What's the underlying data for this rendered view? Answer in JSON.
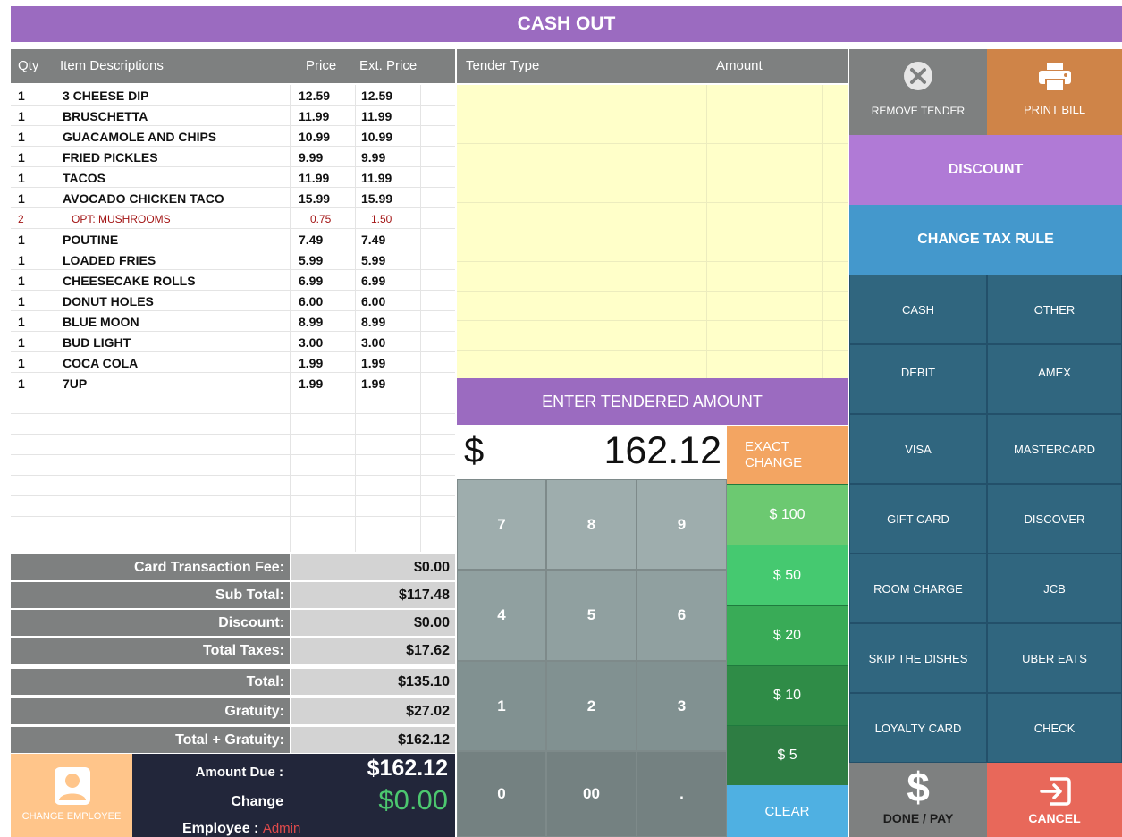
{
  "title": "CASH OUT",
  "items_table": {
    "headers": {
      "qty": "Qty",
      "desc": "Item Descriptions",
      "price": "Price",
      "ext": "Ext. Price"
    },
    "rows": [
      {
        "qty": "1",
        "desc": "3 CHEESE DIP",
        "price": "12.59",
        "ext": "12.59"
      },
      {
        "qty": "1",
        "desc": "BRUSCHETTA",
        "price": "11.99",
        "ext": "11.99"
      },
      {
        "qty": "1",
        "desc": "GUACAMOLE AND CHIPS",
        "price": "10.99",
        "ext": "10.99"
      },
      {
        "qty": "1",
        "desc": "FRIED PICKLES",
        "price": "9.99",
        "ext": "9.99"
      },
      {
        "qty": "1",
        "desc": "TACOS",
        "price": "11.99",
        "ext": "11.99"
      },
      {
        "qty": "1",
        "desc": "AVOCADO CHICKEN TACO",
        "price": "15.99",
        "ext": "15.99"
      },
      {
        "qty": "2",
        "desc": "OPT: MUSHROOMS",
        "price": "0.75",
        "ext": "1.50"
      },
      {
        "qty": "1",
        "desc": "POUTINE",
        "price": "7.49",
        "ext": "7.49"
      },
      {
        "qty": "1",
        "desc": "LOADED FRIES",
        "price": "5.99",
        "ext": "5.99"
      },
      {
        "qty": "1",
        "desc": "CHEESECAKE ROLLS",
        "price": "6.99",
        "ext": "6.99"
      },
      {
        "qty": "1",
        "desc": "DONUT HOLES",
        "price": "6.00",
        "ext": "6.00"
      },
      {
        "qty": "1",
        "desc": "BLUE MOON",
        "price": "8.99",
        "ext": "8.99"
      },
      {
        "qty": "1",
        "desc": "BUD LIGHT",
        "price": "3.00",
        "ext": "3.00"
      },
      {
        "qty": "1",
        "desc": "COCA COLA",
        "price": "1.99",
        "ext": "1.99"
      },
      {
        "qty": "1",
        "desc": "7UP",
        "price": "1.99",
        "ext": "1.99"
      }
    ]
  },
  "totals": [
    {
      "label": "Card Transaction Fee:",
      "value": "$0.00"
    },
    {
      "label": "Sub Total:",
      "value": "$117.48"
    },
    {
      "label": "Discount:",
      "value": "$0.00"
    },
    {
      "label": "Total Taxes:",
      "value": "$17.62"
    },
    {
      "label": "Total:",
      "value": "$135.10"
    },
    {
      "label": "Gratuity:",
      "value": "$27.02"
    },
    {
      "label": "Total + Gratuity:",
      "value": "$162.12"
    }
  ],
  "footer": {
    "change_employee": "CHANGE EMPLOYEE",
    "amount_due_label": "Amount Due :",
    "amount_due_value": "$162.12",
    "change_label": "Change",
    "change_value": "$0.00",
    "employee_label": "Employee :",
    "employee_name": "Admin"
  },
  "tender_table": {
    "type_header": "Tender Type",
    "amount_header": "Amount"
  },
  "enter_tendered": "ENTER TENDERED AMOUNT",
  "amount_display": {
    "currency": "$",
    "value": "162.12"
  },
  "keypad": [
    "7",
    "8",
    "9",
    "4",
    "5",
    "6",
    "1",
    "2",
    "3",
    "0",
    "00",
    "."
  ],
  "cash_buttons": {
    "exact_change": "EXACT CHANGE",
    "b100": "$ 100",
    "b50": "$ 50",
    "b20": "$ 20",
    "b10": "$ 10",
    "b5": "$ 5",
    "clear": "CLEAR"
  },
  "actions": {
    "remove_tender": "REMOVE TENDER",
    "print_bill": "PRINT BILL",
    "discount": "DISCOUNT",
    "change_tax_rule": "CHANGE TAX RULE",
    "done_pay": "DONE / PAY",
    "cancel": "CANCEL"
  },
  "payment_methods": [
    "CASH",
    "OTHER",
    "DEBIT",
    "AMEX",
    "VISA",
    "MASTERCARD",
    "GIFT CARD",
    "DISCOVER",
    "ROOM CHARGE",
    "JCB",
    "SKIP THE DISHES",
    "UBER EATS",
    "LOYALTY CARD",
    "CHECK"
  ],
  "icons": {
    "remove_tender": "close-circle-icon",
    "print_bill": "printer-icon",
    "change_employee": "person-icon",
    "done_pay": "dollar-icon",
    "cancel": "exit-icon"
  },
  "colors": {
    "title_bar": "#9b6bc0",
    "header": "#7e8080",
    "tender_area": "#ffffc9",
    "exact_change": "#f3a562",
    "cash_100": "#6cc971",
    "cash_50": "#45c970",
    "cash_20": "#39ab57",
    "cash_10": "#2f8c47",
    "cash_5": "#2e7d43",
    "clear": "#4fb0e2",
    "payment": "#30667f",
    "print_bill": "#cf8448",
    "discount": "#b07ad6",
    "change_tax": "#4498cc",
    "done_pay": "#7e8080",
    "cancel": "#e8685a",
    "change_value": "#4cc76f",
    "employee_name": "#e24b4b"
  }
}
